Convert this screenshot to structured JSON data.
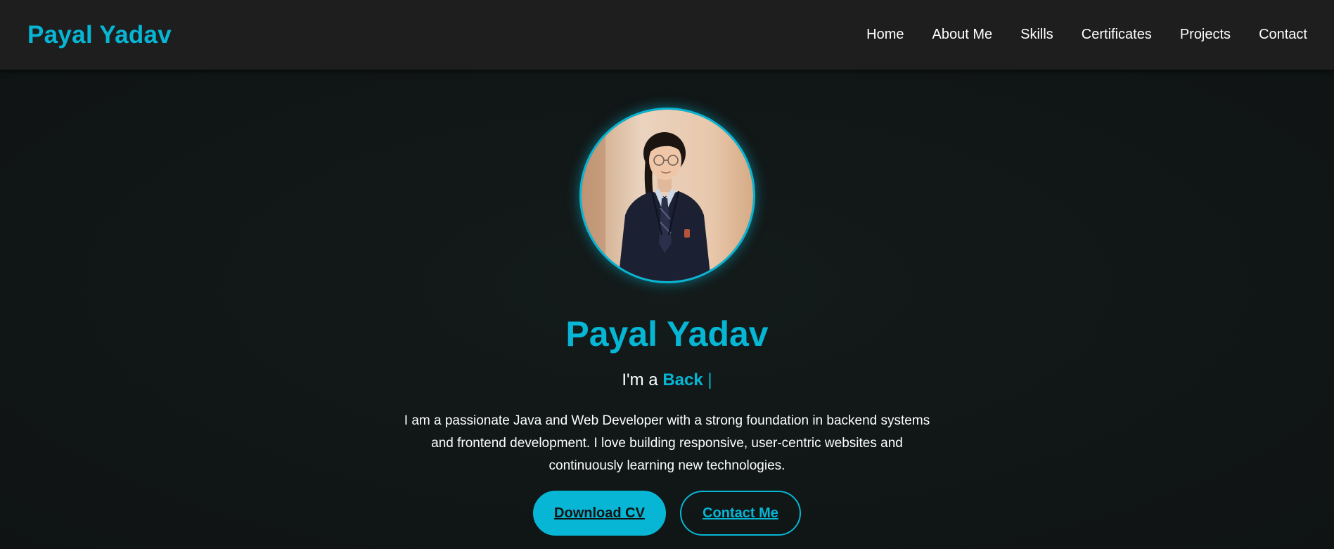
{
  "header": {
    "brand": "Payal Yadav",
    "nav": [
      {
        "label": "Home"
      },
      {
        "label": "About Me"
      },
      {
        "label": "Skills"
      },
      {
        "label": "Certificates"
      },
      {
        "label": "Projects"
      },
      {
        "label": "Contact"
      }
    ]
  },
  "hero": {
    "name": "Payal Yadav",
    "typing_prefix": "I'm a ",
    "typing_word": "Back",
    "typing_cursor": " |",
    "bio": "I am a passionate Java and Web Developer with a strong foundation in backend systems and frontend development. I love building responsive, user-centric websites and continuously learning new technologies.",
    "download_cv_label": "Download CV",
    "contact_label": "Contact Me"
  },
  "colors": {
    "accent": "#06b6d4",
    "navbar_bg": "#1e1e1e",
    "page_bg": "#121616",
    "text": "#ffffff"
  }
}
